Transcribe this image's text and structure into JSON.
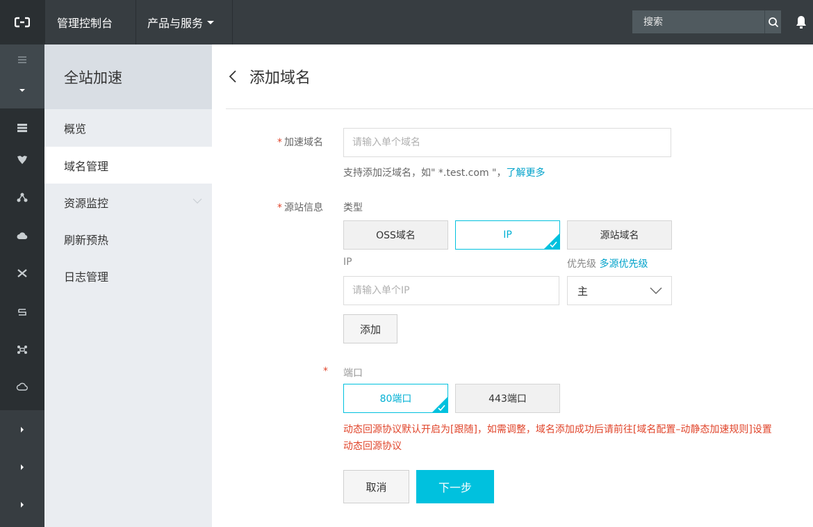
{
  "topbar": {
    "console_label": "管理控制台",
    "products_label": "产品与服务",
    "search_placeholder": "搜索"
  },
  "sidebar": {
    "title": "全站加速",
    "items": [
      {
        "label": "概览"
      },
      {
        "label": "域名管理"
      },
      {
        "label": "资源监控"
      },
      {
        "label": "刷新预热"
      },
      {
        "label": "日志管理"
      }
    ]
  },
  "page": {
    "title": "添加域名"
  },
  "form": {
    "domain": {
      "required_mark": "*",
      "label": "加速域名",
      "placeholder": "请输入单个域名",
      "hint": "支持添加泛域名，如\" *.test.com \"，",
      "hint_link": "了解更多"
    },
    "origin": {
      "required_mark": "*",
      "label": "源站信息",
      "type_label": "类型",
      "types": [
        {
          "label": "OSS域名",
          "selected": false
        },
        {
          "label": "IP",
          "selected": true
        },
        {
          "label": "源站域名",
          "selected": false
        }
      ],
      "ip_label": "IP",
      "ip_placeholder": "请输入单个IP",
      "priority_label": "优先级",
      "priority_link": "多源优先级",
      "priority_value": "主",
      "add_label": "添加"
    },
    "port": {
      "required_mark": "*",
      "label": "端口",
      "options": [
        {
          "label": "80端口",
          "selected": true
        },
        {
          "label": "443端口",
          "selected": false
        }
      ],
      "warning": "动态回源协议默认开启为[跟随]，如需调整，域名添加成功后请前往[域名配置–动静态加速规则]设置动态回源协议"
    },
    "cancel_label": "取消",
    "next_label": "下一步"
  },
  "colors": {
    "accent": "#00c1de",
    "link": "#00a2ca",
    "warning": "#e0452b",
    "topbar": "#373d41"
  }
}
